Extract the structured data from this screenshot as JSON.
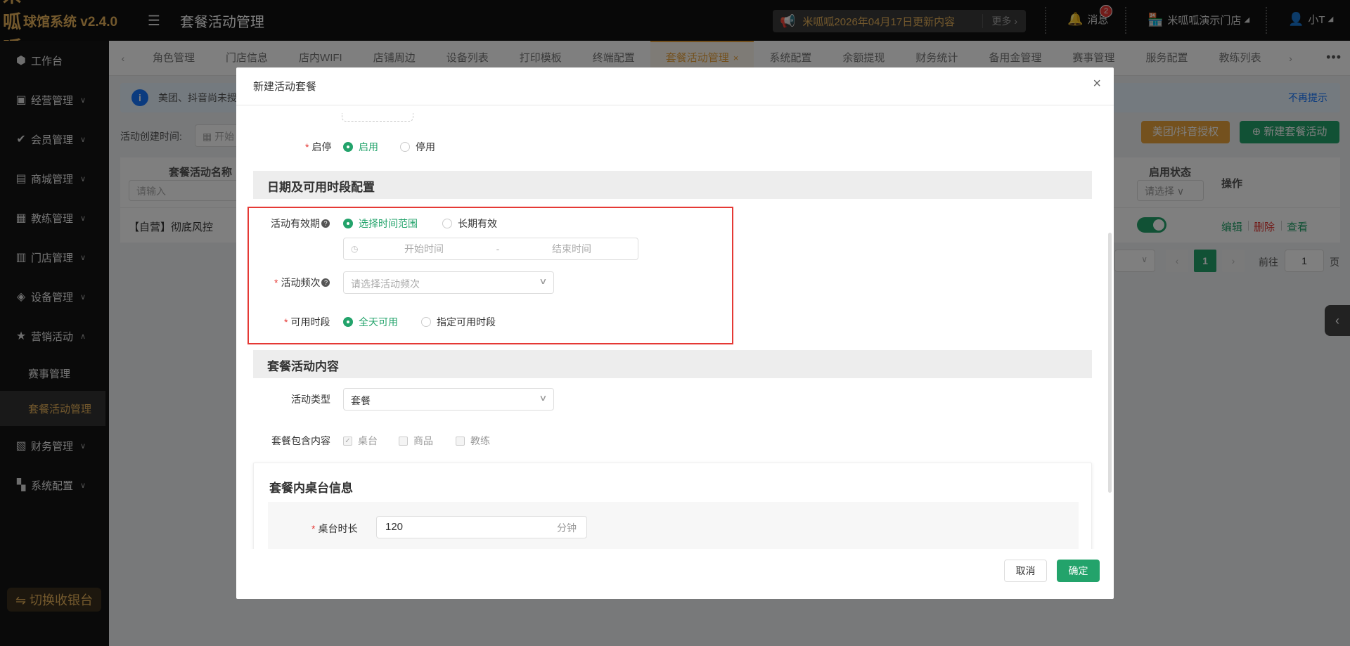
{
  "app": {
    "logo_text": "米呱呱",
    "brand": "球馆系统 v2.4.0",
    "page_title": "套餐活动管理"
  },
  "header": {
    "notice": "米呱呱2026年04月17日更新内容",
    "notice_more": "更多",
    "messages_label": "消息",
    "messages_count": "2",
    "store_name": "米呱呱演示门店",
    "user_name": "小T"
  },
  "sidebar": {
    "items": [
      {
        "label": "工作台",
        "icon": "cube-icon"
      },
      {
        "label": "经营管理",
        "icon": "chart-icon"
      },
      {
        "label": "会员管理",
        "icon": "member-icon"
      },
      {
        "label": "商城管理",
        "icon": "shop-icon"
      },
      {
        "label": "教练管理",
        "icon": "coach-icon"
      },
      {
        "label": "门店管理",
        "icon": "store-icon"
      },
      {
        "label": "设备管理",
        "icon": "device-icon"
      },
      {
        "label": "营销活动",
        "icon": "star-icon"
      },
      {
        "label": "赛事管理",
        "icon": ""
      },
      {
        "label": "套餐活动管理",
        "icon": ""
      },
      {
        "label": "财务管理",
        "icon": "finance-icon"
      },
      {
        "label": "系统配置",
        "icon": "grid-icon"
      }
    ],
    "switch_label": "⇋ 切换收银台"
  },
  "tabs": [
    "角色管理",
    "门店信息",
    "店内WIFI",
    "店铺周边",
    "设备列表",
    "打印模板",
    "终端配置",
    "套餐活动管理",
    "系统配置",
    "余额提现",
    "财务统计",
    "备用金管理",
    "赛事管理",
    "服务配置",
    "教练列表"
  ],
  "background": {
    "info_text": "美团、抖音尚未授",
    "info_dismiss": "不再提示",
    "filter_label": "活动创建时间:",
    "filter_date_placeholder": "开始",
    "auth_button": "美团/抖音授权",
    "new_button": "新建套餐活动",
    "col_name": "套餐活动名称",
    "col_name_placeholder": "请输入",
    "col_status": "启用状态",
    "col_status_placeholder": "请选择",
    "col_ops": "操作",
    "row_name": "【自营】彻底风控",
    "row_enabled": true,
    "op_edit": "编辑",
    "op_delete": "删除",
    "op_view": "查看",
    "page_current": "1",
    "page_goto": "前往",
    "page_input": "1",
    "page_unit": "页"
  },
  "modal": {
    "title": "新建活动套餐",
    "enable_label": "启停",
    "enable_on": "启用",
    "enable_off": "停用",
    "section_date": "日期及可用时段配置",
    "validity_label": "活动有效期",
    "validity_range": "选择时间范围",
    "validity_long": "长期有效",
    "start_placeholder": "开始时间",
    "range_sep": "-",
    "end_placeholder": "结束时间",
    "frequency_label": "活动频次",
    "frequency_placeholder": "请选择活动频次",
    "available_label": "可用时段",
    "available_all": "全天可用",
    "available_custom": "指定可用时段",
    "section_content": "套餐活动内容",
    "type_label": "活动类型",
    "type_value": "套餐",
    "includes_label": "套餐包含内容",
    "include_table": "桌台",
    "include_goods": "商品",
    "include_coach": "教练",
    "card_title": "套餐内桌台信息",
    "duration_label": "桌台时长",
    "duration_value": "120",
    "duration_unit": "分钟",
    "cancel": "取消",
    "confirm": "确定"
  },
  "colors": {
    "accent_green": "#23a36b",
    "accent_gold": "#e8a33d",
    "highlight_red": "#e53935"
  }
}
